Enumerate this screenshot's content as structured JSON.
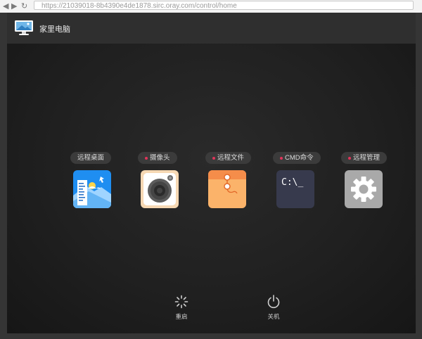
{
  "browser": {
    "url": "https://21039018-8b4390e4de1878.sirc.oray.com/control/home"
  },
  "header": {
    "device_name": "家里电脑"
  },
  "apps": [
    {
      "label": "远程桌面",
      "has_dot": false,
      "icon": "remote-desktop-icon"
    },
    {
      "label": "摄像头",
      "has_dot": true,
      "icon": "camera-icon"
    },
    {
      "label": "远程文件",
      "has_dot": true,
      "icon": "remote-file-icon"
    },
    {
      "label": "CMD命令",
      "has_dot": true,
      "icon": "cmd-icon",
      "icon_text": "C:\\_"
    },
    {
      "label": "远程管理",
      "has_dot": true,
      "icon": "gear-icon"
    }
  ],
  "power": {
    "restart_label": "重启",
    "shutdown_label": "关机"
  },
  "colors": {
    "background": "#222222",
    "pill": "#3b3b3b",
    "dot": "#e0345a",
    "desktop_blue": "#2196f3",
    "camera_bg": "#f6d8b3",
    "file_orange": "#fbb36a",
    "cmd_bg": "#373a4d",
    "gear_bg": "#a9a9a9"
  }
}
